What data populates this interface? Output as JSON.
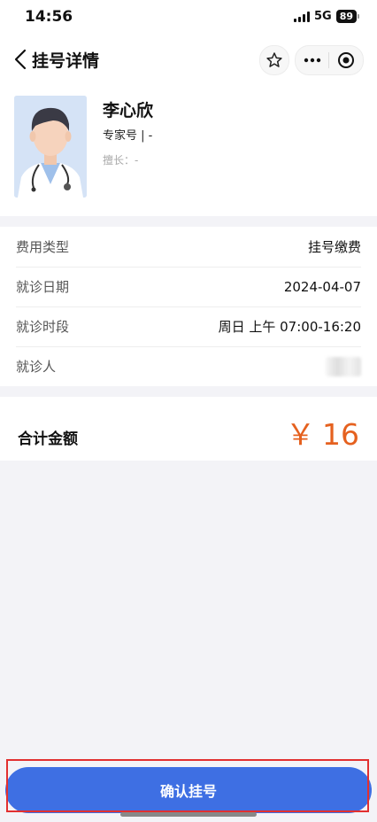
{
  "status": {
    "time": "14:56",
    "network": "5G",
    "battery": "89"
  },
  "nav": {
    "title": "挂号详情"
  },
  "icons": {
    "back": "chevron-left-icon",
    "favorite": "star-outline-icon",
    "more": "more-dots-icon",
    "close": "target-close-icon"
  },
  "doctor": {
    "name": "李心欣",
    "level": "专家号 | -",
    "specialty": "擅长：-"
  },
  "info": [
    {
      "label": "费用类型",
      "value": "挂号缴费"
    },
    {
      "label": "就诊日期",
      "value": "2024-04-07"
    },
    {
      "label": "就诊时段",
      "value": "周日 上午 07:00-16:20"
    },
    {
      "label": "就诊人",
      "value": ""
    }
  ],
  "total": {
    "label": "合计金额",
    "currency": "￥",
    "amount": "16"
  },
  "confirm": {
    "label": "确认挂号"
  },
  "colors": {
    "primary": "#3e6fe3",
    "price": "#e5611f",
    "highlight": "#e23030"
  }
}
